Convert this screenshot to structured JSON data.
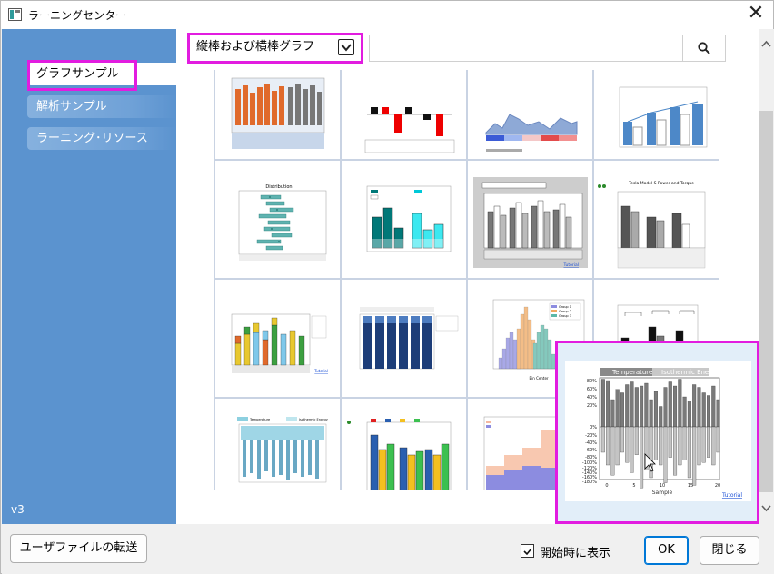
{
  "window": {
    "title": "ラーニングセンター"
  },
  "sidebar": {
    "items": [
      {
        "label": "グラフサンプル",
        "active": true
      },
      {
        "label": "解析サンプル",
        "active": false
      },
      {
        "label": "ラーニング･リソース",
        "active": false
      }
    ],
    "version": "v3"
  },
  "toolbar": {
    "category_selected": "縦棒および横棒グラフ",
    "search_value": ""
  },
  "thumbnails": {
    "link_label": "Tutorial",
    "row2": [
      {
        "title": "Distribution"
      },
      {
        "title": ""
      },
      {
        "title": ""
      },
      {
        "title": "Tesla Model S Power and Torque"
      }
    ],
    "row3_legend": [
      "Group 1",
      "Group 2",
      "Group 3"
    ],
    "row3_xlabel": "Bin Center",
    "row4_legend": [
      "Temperature",
      "Isothermic Energy"
    ]
  },
  "preview": {
    "legend": [
      "Temperature",
      "Isothermic Energy"
    ],
    "xlabel": "Sample",
    "link": "Tutorial",
    "x_ticks": [
      "0",
      "5",
      "10",
      "15",
      "20"
    ],
    "y_ticks": [
      "80%",
      "60%",
      "40%",
      "20%",
      "0%",
      "-20%",
      "-40%",
      "-60%",
      "-80%",
      "-100%",
      "-120%",
      "-140%",
      "-160%",
      "-180%"
    ]
  },
  "footer": {
    "transfer_label": "ユーザファイルの転送",
    "show_on_start_label": "開始時に表示",
    "show_on_start_checked": true,
    "ok_label": "OK",
    "close_label": "閉じる"
  },
  "colors": {
    "sidebar": "#5b93cf",
    "highlight": "#e21ce0",
    "accent": "#0078d7"
  }
}
